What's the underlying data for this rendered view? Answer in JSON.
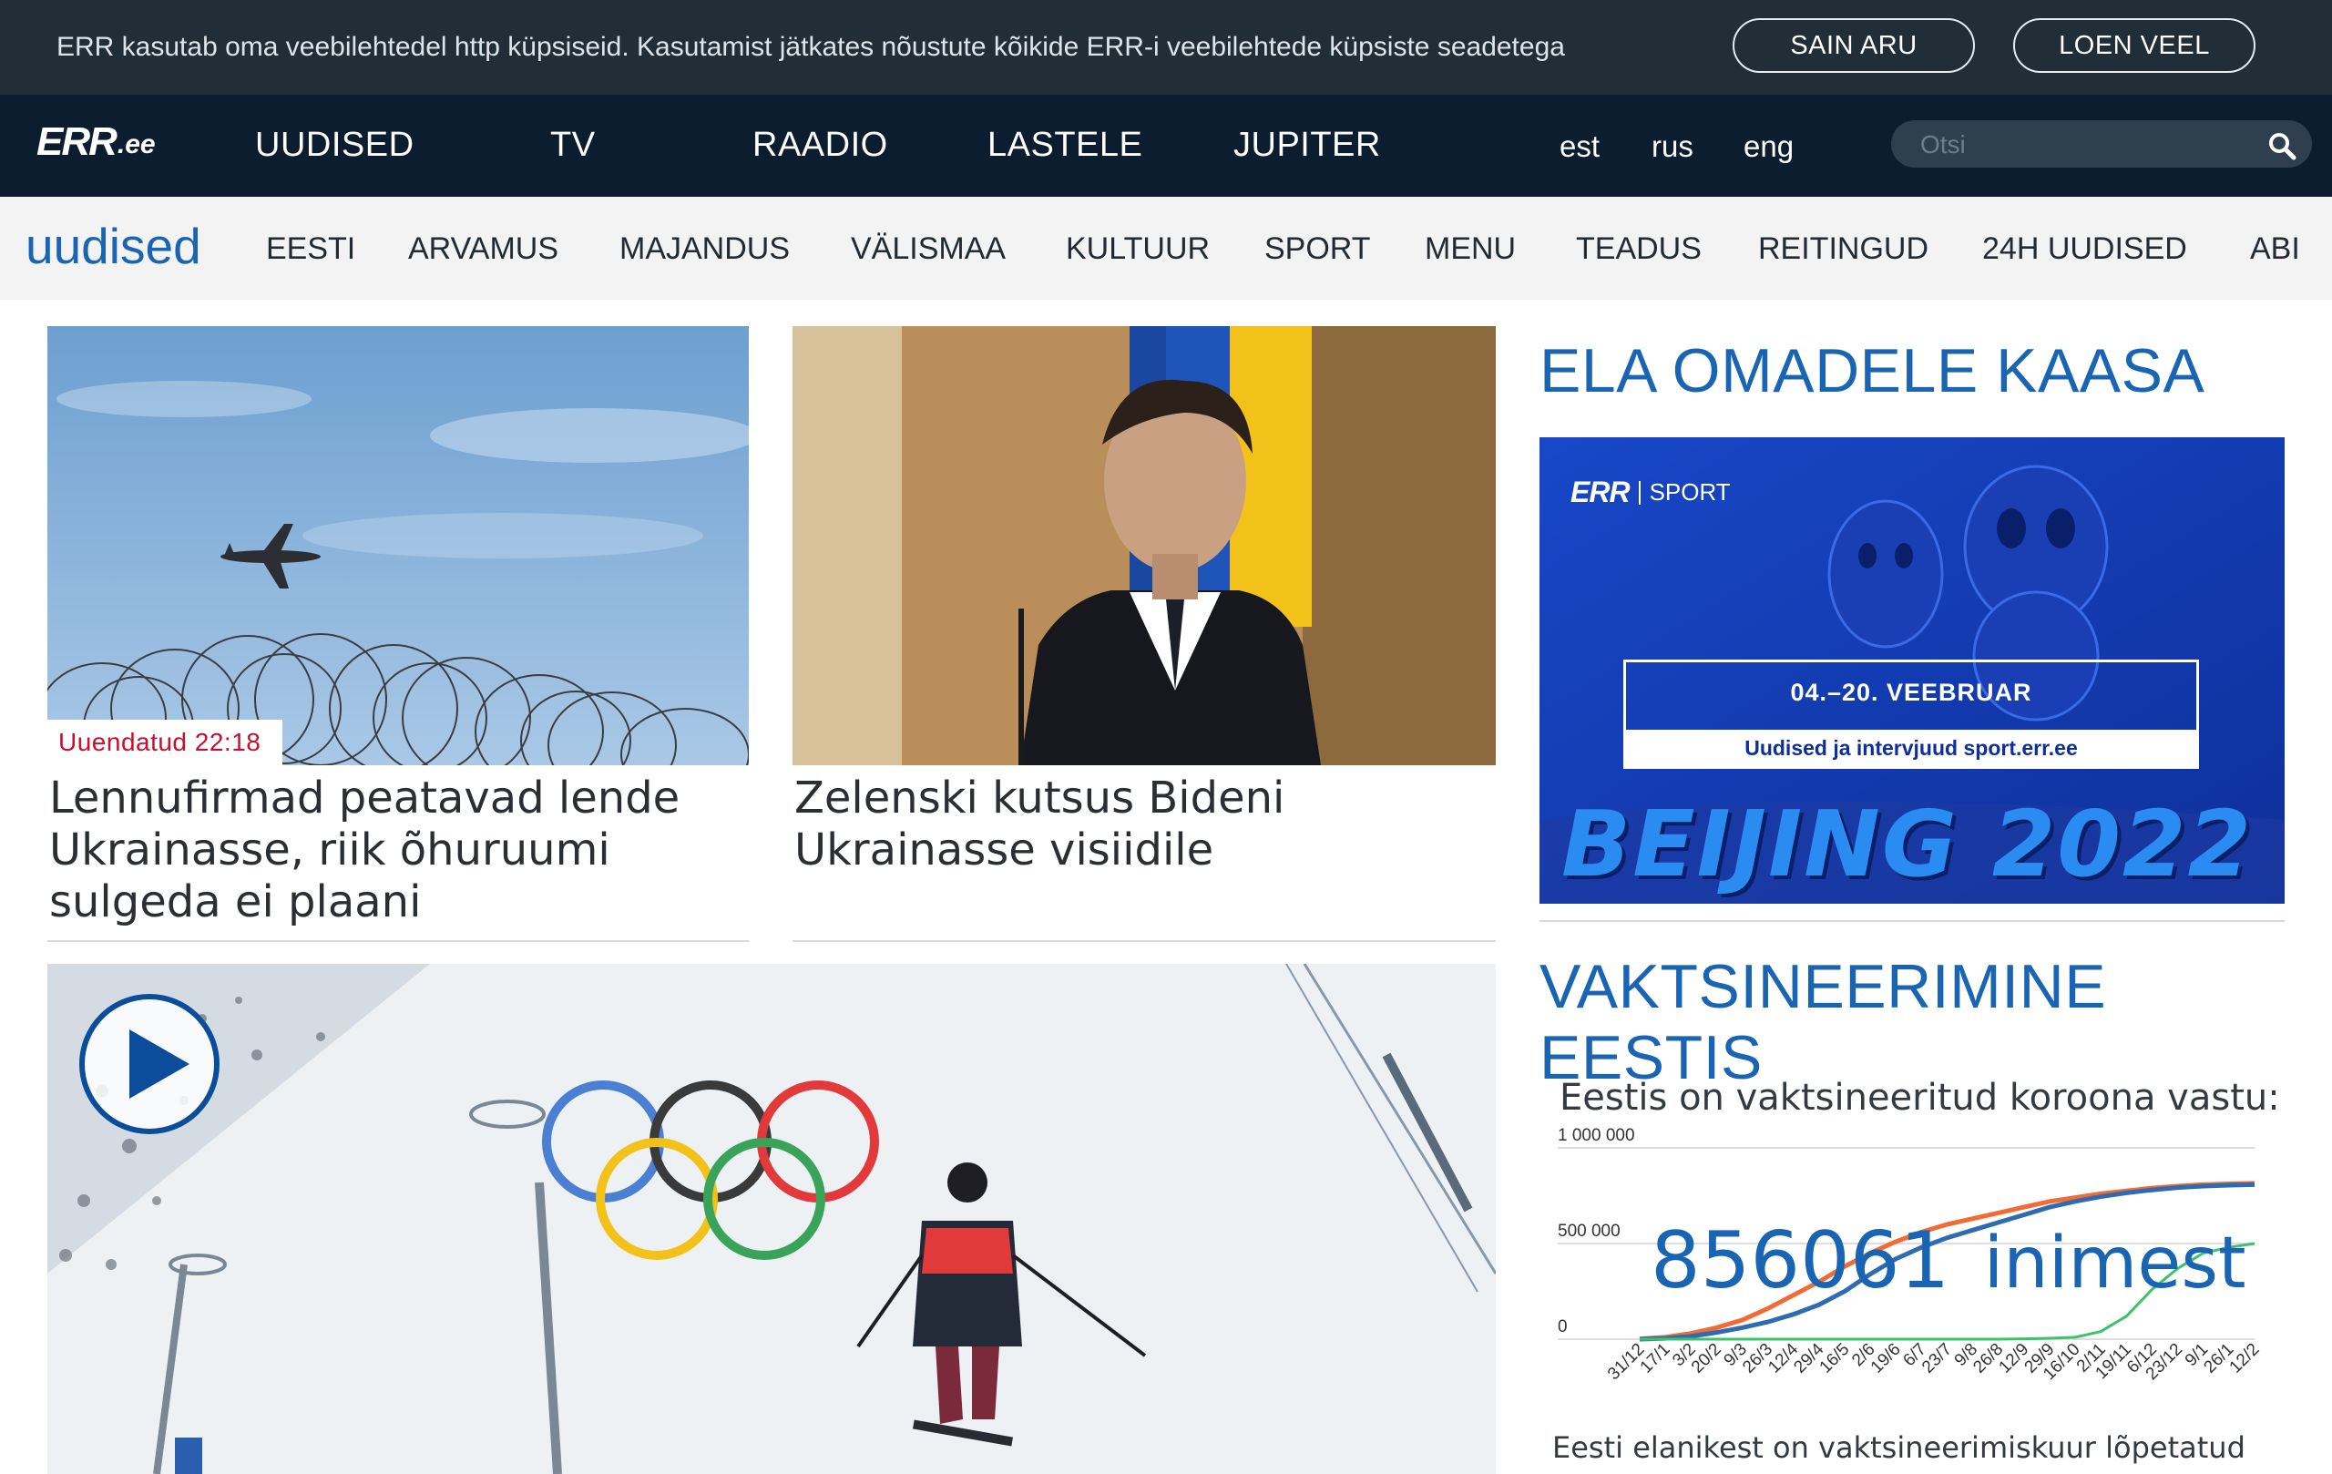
{
  "cookie_bar": {
    "text": "ERR kasutab oma veebilehtedel http küpsiseid. Kasutamist jätkates nõustute kõikide ERR-i veebilehtede küpsiste seadetega",
    "accept_label": "SAIN ARU",
    "more_label": "LOEN VEEL"
  },
  "header": {
    "logo_mark": "ERR",
    "logo_suffix": ".ee",
    "nav": [
      "UUDISED",
      "TV",
      "RAADIO",
      "LASTELE",
      "JUPITER"
    ],
    "languages": [
      "est",
      "rus",
      "eng"
    ],
    "search_placeholder": "Otsi"
  },
  "subnav": {
    "section_title": "uudised",
    "items": [
      "EESTI",
      "ARVAMUS",
      "MAJANDUS",
      "VÄLISMAA",
      "KULTUUR",
      "SPORT",
      "MENU",
      "TEADUS",
      "REITINGUD",
      "24H UUDISED",
      "ABI"
    ]
  },
  "articles": [
    {
      "badge": "Uuendatud 22:18",
      "headline": "Lennufirmad peatavad lende Ukrainasse, riik õhuruumi sulgeda ei plaani"
    },
    {
      "headline": "Zelenski kutsus Bideni Ukrainasse visiidile"
    },
    {
      "headline": ""
    }
  ],
  "sidebar": {
    "heading1": "ELA OMADELE KAASA",
    "ad": {
      "brand": "ERR",
      "brand_section": "SPORT",
      "dates": "04.–20. VEEBRUAR",
      "tagline": "Uudised ja intervjuud sport.err.ee",
      "event": "BEIJING 2022"
    },
    "heading2": "VAKTSINEERIMINE EESTIS",
    "vaccination": {
      "intro": "Eestis on vaktsineeritud koroona vastu:",
      "count": "856061",
      "count_unit": "inimest",
      "footer": "Eesti elanikest on vaktsineerimiskuur lõpetatud"
    }
  },
  "colors": {
    "cookie_bg": "#212d37",
    "nav_bg": "#0c1d2f",
    "subnav_bg": "#f3f3f3",
    "brand_blue": "#1a64b4",
    "badge_red": "#c8102e",
    "series_orange": "#f26a36",
    "series_blue": "#2e6bb0",
    "series_green": "#3cc36a"
  },
  "icons": [
    "search-icon",
    "play-icon"
  ],
  "chart_data": {
    "type": "line",
    "title": "",
    "xlabel": "",
    "ylabel": "",
    "ylim": [
      0,
      1000000
    ],
    "y_ticks": [
      "0",
      "500 000",
      "1 000 000"
    ],
    "categories": [
      "31/12",
      "17/1",
      "3/2",
      "20/2",
      "9/3",
      "26/3",
      "12/4",
      "29/4",
      "16/5",
      "2/6",
      "19/6",
      "6/7",
      "23/7",
      "9/8",
      "26/8",
      "12/9",
      "29/9",
      "16/10",
      "2/11",
      "19/11",
      "6/12",
      "23/12",
      "9/1",
      "26/1",
      "12/2"
    ],
    "series": [
      {
        "values": [
          2000,
          10000,
          30000,
          60000,
          100000,
          160000,
          230000,
          300000,
          380000,
          450000,
          510000,
          560000,
          600000,
          630000,
          660000,
          690000,
          720000,
          740000,
          760000,
          775000,
          790000,
          800000,
          808000,
          812000,
          815000
        ]
      },
      {
        "values": [
          0,
          4000,
          15000,
          35000,
          60000,
          90000,
          130000,
          180000,
          250000,
          340000,
          420000,
          480000,
          530000,
          570000,
          610000,
          650000,
          690000,
          720000,
          745000,
          765000,
          780000,
          792000,
          800000,
          805000,
          808000
        ]
      },
      {
        "values": [
          0,
          0,
          0,
          0,
          0,
          0,
          0,
          0,
          0,
          0,
          0,
          0,
          0,
          0,
          0,
          2000,
          5000,
          10000,
          40000,
          120000,
          260000,
          370000,
          450000,
          480000,
          500000
        ]
      }
    ]
  }
}
